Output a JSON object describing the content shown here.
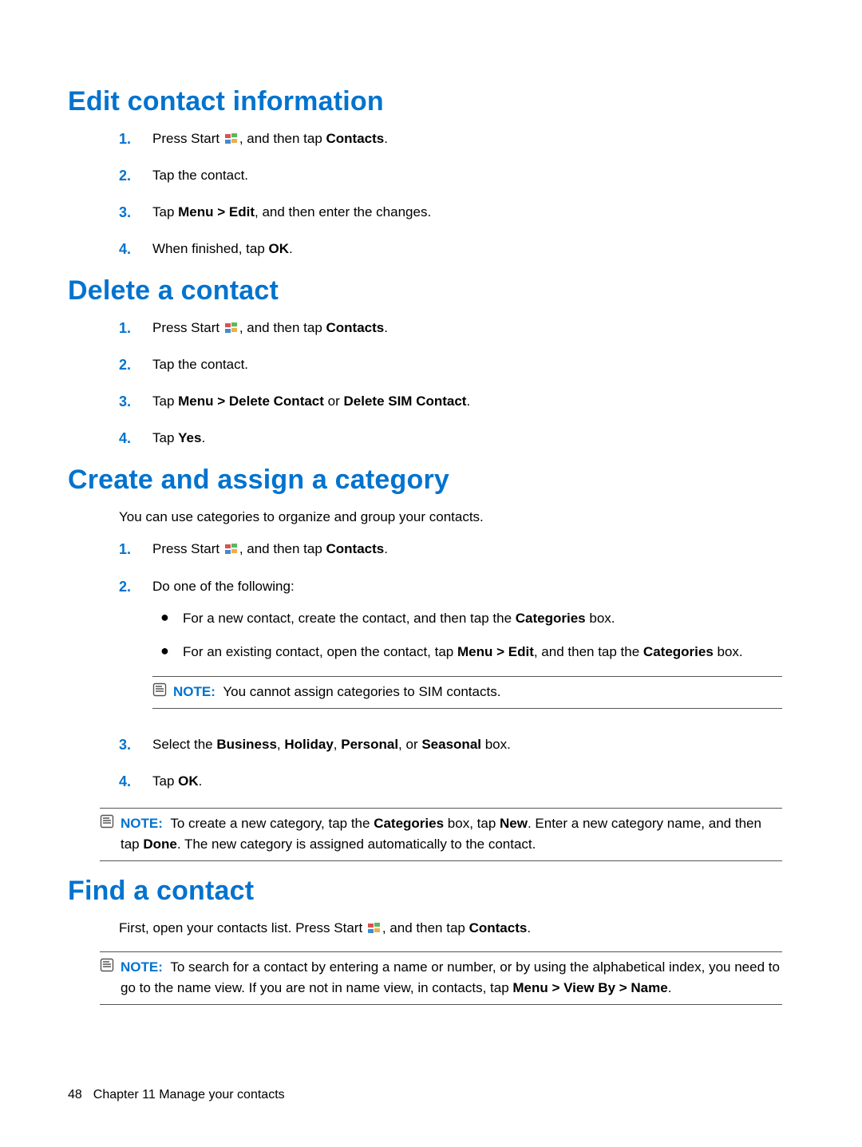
{
  "headings": {
    "edit": "Edit contact information",
    "delete": "Delete a contact",
    "category": "Create and assign a category",
    "find": "Find a contact"
  },
  "steps": {
    "pressStartPrefix": "Press Start ",
    "pressStartSuffix": ", and then tap ",
    "contacts": "Contacts",
    "tapContact": "Tap the contact.",
    "menuEdit": "Menu > Edit",
    "editChanges": ", and then enter the changes.",
    "whenFinished": "When finished, tap ",
    "ok": "OK",
    "tap": "Tap ",
    "menuDelete": "Menu > Delete Contact",
    "or": " or ",
    "deleteSim": "Delete SIM Contact",
    "yes": "Yes",
    "doOne": "Do one of the following:",
    "selectThe": "Select the ",
    "business": "Business",
    "holiday": "Holiday",
    "personal": "Personal",
    "orWord": ", or ",
    "seasonal": "Seasonal",
    "boxWord": " box.",
    "period": ".",
    "comma": ", "
  },
  "intro": {
    "category": "You can use categories to organize and group your contacts.",
    "findPrefix": "First, open your contacts list. Press Start ",
    "findSuffix": ", and then tap "
  },
  "bullets": {
    "newContactPrefix": "For a new contact, create the contact, and then tap the ",
    "categoriesBox": "Categories",
    "existingPrefix": "For an existing contact, open the contact, tap ",
    "existingMid": ", and then tap the ",
    "boxSuffix": " box."
  },
  "notes": {
    "label": "NOTE:",
    "simNote": "You cannot assign categories to SIM contacts.",
    "newCatPrefix": "To create a new category, tap the ",
    "newCatMid1": " box, tap ",
    "new": "New",
    "newCatMid2": ". Enter a new category name, and then tap ",
    "done": "Done",
    "newCatSuffix": ". The new category is assigned automatically to the contact.",
    "findNotePrefix": "To search for a contact by entering a name or number, or by using the alphabetical index, you need to go to the name view. If you are not in name view, in contacts, tap ",
    "menuViewBy": "Menu > View By > Name"
  },
  "footer": {
    "page": "48",
    "chapter": "Chapter 11   Manage your contacts"
  },
  "icons": {
    "note": "note-icon",
    "winflag": "windows-start-icon"
  }
}
